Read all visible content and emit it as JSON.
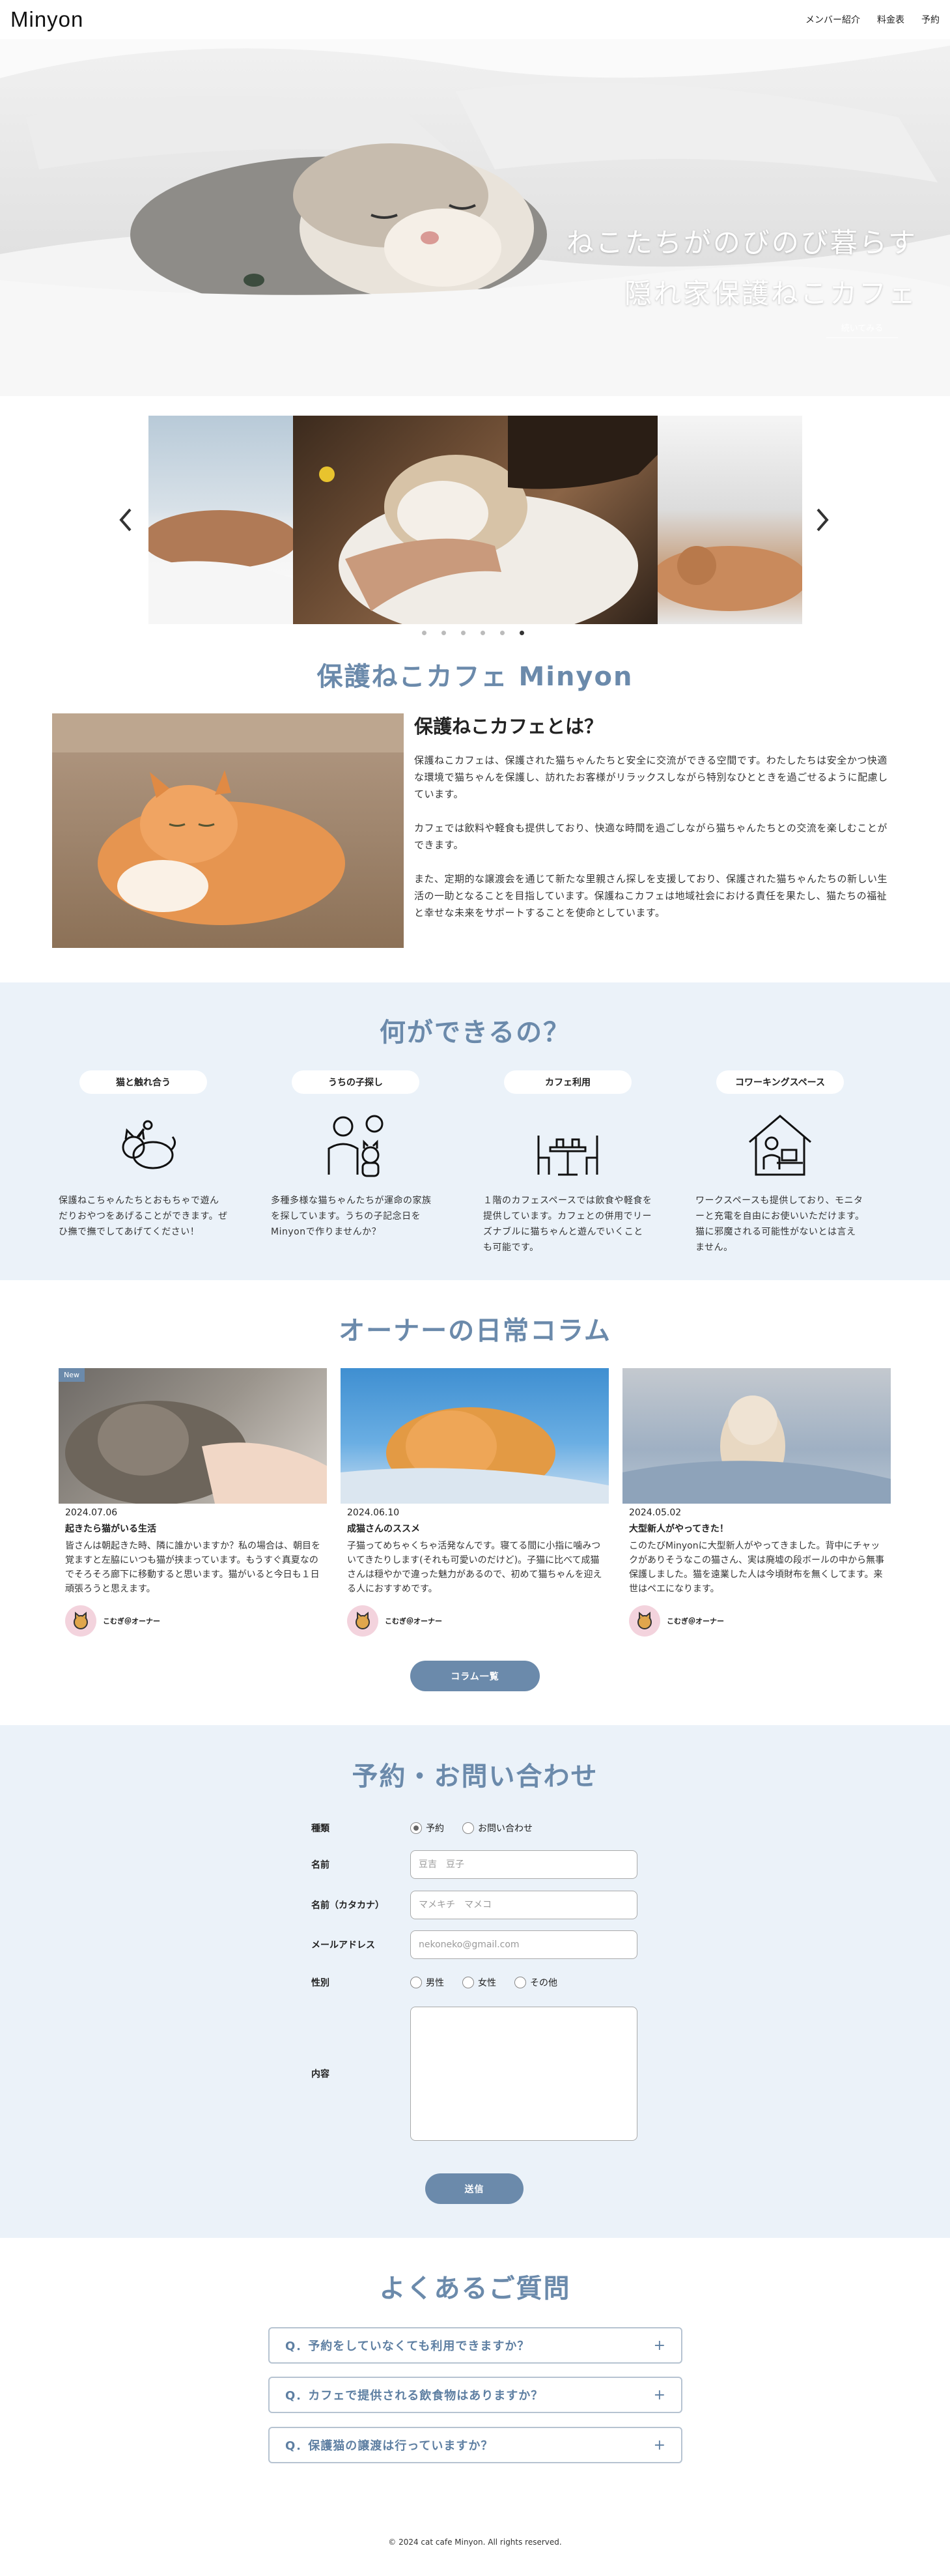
{
  "header": {
    "logo": "Minyon",
    "nav": [
      "メンバー紹介",
      "料金表",
      "予約"
    ]
  },
  "hero": {
    "line1": "ねこたちがのびのび暮らす",
    "line2": "隠れ家保護ねこカフェ",
    "more": "続いてみる"
  },
  "slider": {
    "prev_icon": "chevron-left-icon",
    "next_icon": "chevron-right-icon",
    "dot_count": 6,
    "active_dot": 5
  },
  "about": {
    "section_title": "保護ねこカフェ Minyon",
    "heading": "保護ねこカフェとは？",
    "p1": "保護ねこカフェは、保護された猫ちゃんたちと安全に交流ができる空間です。わたしたちは安全かつ快適な環境で猫ちゃんを保護し、訪れたお客様がリラックスしながら特別なひとときを過ごせるように配慮しています。",
    "p2": "カフェでは飲料や軽食も提供しており、快適な時間を過ごしながら猫ちゃんたちとの交流を楽しむことができます。",
    "p3": "また、定期的な譲渡会を通じて新たな里親さん探しを支援しており、保護された猫ちゃんたちの新しい生活の一助となることを目指しています。保護ねこカフェは地域社会における責任を果たし、猫たちの福祉と幸せな未来をサポートすることを使命としています。"
  },
  "what": {
    "section_title": "何ができるの？",
    "items": [
      {
        "label": "猫と触れ合う",
        "icon": "cat-playing-icon",
        "desc": "保護ねこちゃんたちとおもちゃで遊んだりおやつをあげることができます。ぜひ撫で撫でしてあげてください！"
      },
      {
        "label": "うちの子探し",
        "icon": "person-with-cat-icon",
        "desc": "多種多様な猫ちゃんたちが運命の家族を探しています。うちの子記念日をMinyonで作りませんか？"
      },
      {
        "label": "カフェ利用",
        "icon": "cafe-table-icon",
        "desc": "１階のカフェスペースでは飲食や軽食を提供しています。カフェとの併用でリーズナブルに猫ちゃんと遊んでいくことも可能です。"
      },
      {
        "label": "コワーキングスペース",
        "icon": "remote-work-icon",
        "desc": "ワークスペースも提供しており、モニターと充電を自由にお使いいただけます。猫に邪魔される可能性がないとは言えません。"
      }
    ]
  },
  "column": {
    "section_title": "オーナーの日常コラム",
    "new_badge": "New",
    "author": "こむぎ＠オーナー",
    "button": "コラム一覧",
    "cards": [
      {
        "date": "2024.07.06",
        "title": "起きたら猫がいる生活",
        "text": "皆さんは朝起きた時、隣に誰かいますか？私の場合は、朝目を覚ますと左脇にいつも猫が挟まっています。もうすぐ真夏なのでそろそろ廊下に移動すると思います。猫がいると今日も１日頑張ろうと思えます。"
      },
      {
        "date": "2024.06.10",
        "title": "成猫さんのススメ",
        "text": "子猫ってめちゃくちゃ活発なんです。寝てる間に小指に噛みついてきたりします(それも可愛いのだけど)。子猫に比べて成猫さんは穏やかで違った魅力があるので、初めて猫ちゃんを迎える人におすすめです。"
      },
      {
        "date": "2024.05.02",
        "title": "大型新人がやってきた！",
        "text": "このたびMinyonに大型新人がやってきました。背中にチャックがありそうなこの猫さん、実は廃墟の段ボールの中から無事保護しました。猫を遠業した人は今頃財布を無くしてます。来世はペエになります。"
      }
    ]
  },
  "contact": {
    "section_title": "予約・お問い合わせ",
    "type_label": "種類",
    "type_options": [
      "予約",
      "お問い合わせ"
    ],
    "name_label": "名前",
    "name_placeholder": "豆吉　豆子",
    "kana_label": "名前（カタカナ）",
    "kana_placeholder": "マメキチ　マメコ",
    "email_label": "メールアドレス",
    "email_placeholder": "nekoneko@gmail.com",
    "gender_label": "性別",
    "gender_options": [
      "男性",
      "女性",
      "その他"
    ],
    "content_label": "内容",
    "submit": "送信"
  },
  "faq": {
    "section_title": "よくあるご質問",
    "items": [
      "Q．予約をしていなくても利用できますか？",
      "Q．カフェで提供される飲食物はありますか？",
      "Q．保護猫の譲渡は行っていますか？"
    ],
    "expand_icon": "plus-icon"
  },
  "footer": {
    "copyright": "© 2024 cat cafe Minyon. All rights reserved."
  },
  "colors": {
    "accent": "#6b8aab",
    "section_bg": "#ebf2f9"
  }
}
